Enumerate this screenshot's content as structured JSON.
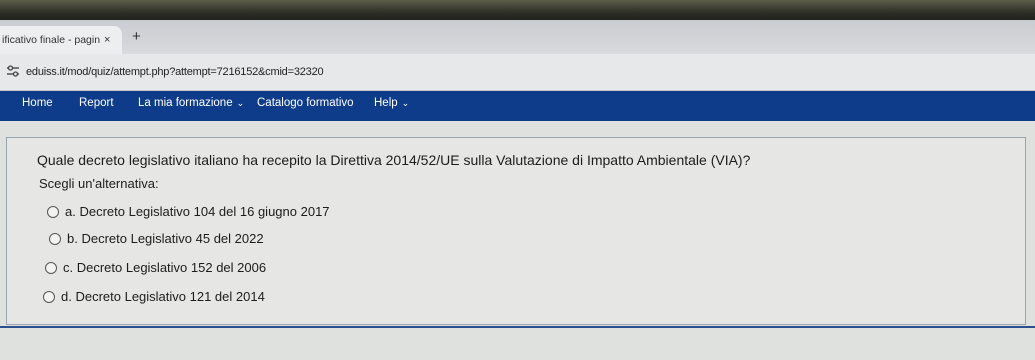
{
  "browser": {
    "tab_title": "ificativo finale - pagina",
    "tab_close": "×",
    "new_tab": "+",
    "url": "eduiss.it/mod/quiz/attempt.php?attempt=7216152&cmid=32320"
  },
  "nav": {
    "items": [
      {
        "label": "Home"
      },
      {
        "label": "Report"
      },
      {
        "label": "La mia formazione",
        "has_dropdown": true
      },
      {
        "label": "Catalogo formativo"
      },
      {
        "label": "Help",
        "has_dropdown": true
      }
    ],
    "chevron": "⌄"
  },
  "quiz": {
    "question": "Quale decreto legislativo italiano ha recepito la Direttiva 2014/52/UE sulla Valutazione di Impatto Ambientale (VIA)?",
    "prompt": "Scegli un'alternativa:",
    "options": [
      "a. Decreto Legislativo 104 del 16 giugno 2017",
      "b. Decreto Legislativo 45 del 2022",
      "c. Decreto Legislativo 152 del 2006",
      "d. Decreto Legislativo 121 del 2014"
    ]
  },
  "colors": {
    "navbar": "#0f3c8a"
  }
}
